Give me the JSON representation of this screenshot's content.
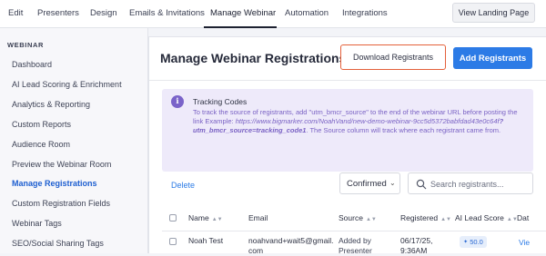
{
  "topnav": {
    "tabs": [
      "Edit",
      "Presenters",
      "Design",
      "Emails & Invitations",
      "Manage Webinar",
      "Automation",
      "Integrations"
    ],
    "active_tab": "Manage Webinar",
    "view_landing_label": "View Landing Page"
  },
  "sidebar": {
    "heading": "WEBINAR",
    "items": [
      "Dashboard",
      "AI Lead Scoring & Enrichment",
      "Analytics & Reporting",
      "Custom Reports",
      "Audience Room",
      "Preview the Webinar Room",
      "Manage Registrations",
      "Custom Registration Fields",
      "Webinar Tags",
      "SEO/Social Sharing Tags"
    ],
    "active_item": "Manage Registrations"
  },
  "main": {
    "title": "Manage Webinar Registrations",
    "download_label": "Download Registrants",
    "add_label": "Add Registrants",
    "notice": {
      "title": "Tracking Codes",
      "body_1": "To track the source of registrants, add \"utm_bmcr_source\" to the end of the webinar URL before posting the link Example: ",
      "link_1": "https://www.bigmarker.com/NoahVand/new-demo-webinar-9cc5d5372babfdad43e0c64f",
      "link_2": "?utm_bmcr_source=tracking_code1",
      "body_2": ". The Source column will track where each registrant came from."
    },
    "delete_label": "Delete",
    "status_filter": "Confirmed",
    "search_placeholder": "Search registrants...",
    "columns": [
      "Name",
      "Email",
      "Source",
      "Registered",
      "AI Lead Score",
      "Dat"
    ],
    "rows": [
      {
        "name": "Noah Test",
        "email_1": "noahvand+wait5@gmail.",
        "email_2": "com",
        "source_1": "Added by",
        "source_2": "Presenter",
        "registered_1": "06/17/25,",
        "registered_2": "9:36AM",
        "score": "50.0",
        "action": "Vie"
      }
    ]
  },
  "colors": {
    "accent_blue": "#2c7be6",
    "download_border": "#e4603a",
    "notice_bg": "#eeeafa",
    "notice_text": "#7a62c4"
  }
}
